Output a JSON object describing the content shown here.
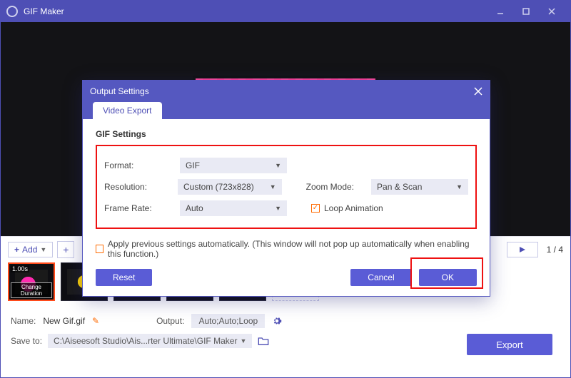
{
  "window": {
    "title": "GIF Maker"
  },
  "timeline": {
    "add_label": "Add",
    "page_indicator": "1 / 4",
    "thumb_duration": "1.00s",
    "change_duration": "Change Duration"
  },
  "footer": {
    "name_label": "Name:",
    "name_value": "New Gif.gif",
    "output_label": "Output:",
    "output_value": "Auto;Auto;Loop",
    "saveto_label": "Save to:",
    "saveto_path": "C:\\Aiseesoft Studio\\Ais...rter Ultimate\\GIF Maker",
    "export_label": "Export"
  },
  "dialog": {
    "title": "Output Settings",
    "tab_video_export": "Video Export",
    "gif_settings_title": "GIF Settings",
    "format_label": "Format:",
    "format_value": "GIF",
    "resolution_label": "Resolution:",
    "resolution_value": "Custom (723x828)",
    "zoom_label": "Zoom Mode:",
    "zoom_value": "Pan & Scan",
    "framerate_label": "Frame Rate:",
    "framerate_value": "Auto",
    "loop_label": "Loop Animation",
    "apply_label": "Apply previous settings automatically. (This window will not pop up automatically when enabling this function.)",
    "reset_label": "Reset",
    "cancel_label": "Cancel",
    "ok_label": "OK"
  }
}
